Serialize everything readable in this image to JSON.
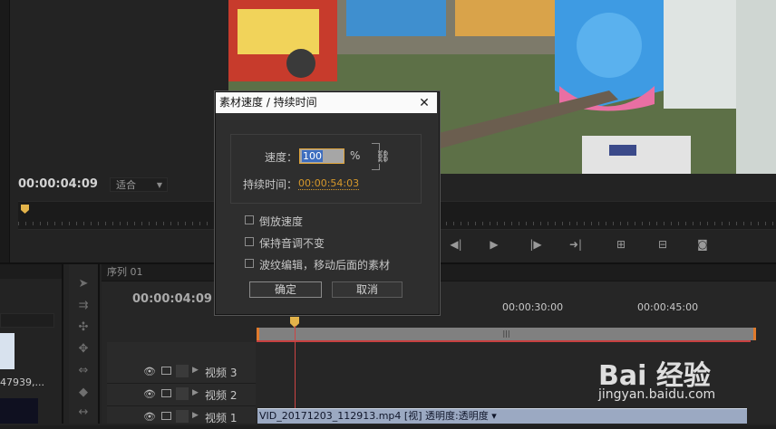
{
  "program_monitor": {
    "timecode": "00:00:04:09",
    "fit_dropdown": "适合"
  },
  "sequence": {
    "tab_label": "序列 01",
    "timecode": "00:00:04:09",
    "ruler_labels": [
      "00:00:30:00",
      "00:00:45:00"
    ],
    "work_bar_glyph": "|||",
    "tracks": [
      {
        "name": "视频 3"
      },
      {
        "name": "视频 2"
      },
      {
        "name": "视频 1"
      }
    ],
    "clip_label": "VID_20171203_112913.mp4 [视] 透明度:透明度 ▾"
  },
  "project_panel": {
    "item_label": "47939,..."
  },
  "dialog": {
    "title": "素材速度 / 持续时间",
    "close": "✕",
    "speed_label": "速度：",
    "speed_value": "100",
    "speed_unit": "%",
    "duration_label": "持续时间：",
    "duration_value": "00:00:54:03",
    "checkboxes": [
      {
        "label": "倒放速度",
        "checked": false
      },
      {
        "label": "保持音调不变",
        "checked": false
      },
      {
        "label": "波纹编辑，移动后面的素材",
        "checked": false
      }
    ],
    "ok_label": "确定",
    "cancel_label": "取消"
  },
  "watermark": {
    "brand": "Bai  经验",
    "url": "jingyan.baidu.com"
  }
}
